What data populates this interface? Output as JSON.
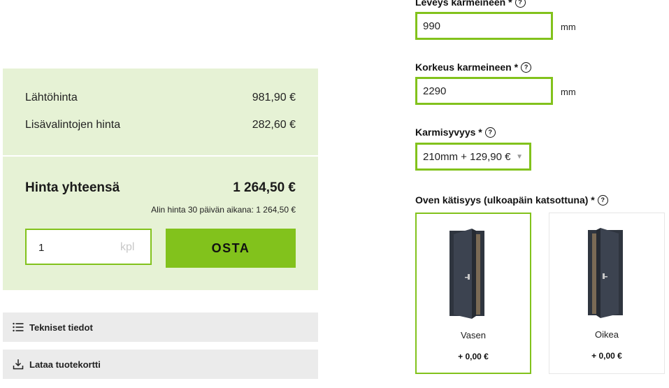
{
  "pricing": {
    "base_label": "Lähtöhinta",
    "base_value": "981,90 €",
    "extras_label": "Lisävalintojen hinta",
    "extras_value": "282,60 €",
    "total_label": "Hinta yhteensä",
    "total_value": "1 264,50 €",
    "lowest_price_note": "Alin hinta 30 päivän aikana: 1 264,50 €"
  },
  "purchase": {
    "quantity": "1",
    "quantity_unit": "kpl",
    "buy_label": "OSTA"
  },
  "accordions": {
    "tech_label": "Tekniset tiedot",
    "download_label": "Lataa tuotekortti"
  },
  "form": {
    "width_label": "Leveys karmeineen *",
    "width_value": "990",
    "width_unit": "mm",
    "height_label": "Korkeus karmeineen *",
    "height_value": "2290",
    "height_unit": "mm",
    "depth_label": "Karmisyvyys *",
    "depth_value": "210mm + 129,90 €",
    "handedness_label": "Oven kätisyys (ulkoapäin katsottuna) *",
    "help_glyph": "?",
    "options": [
      {
        "label": "Vasen",
        "price": "+ 0,00 €",
        "selected": true
      },
      {
        "label": "Oikea",
        "price": "+ 0,00 €",
        "selected": false
      }
    ]
  },
  "colors": {
    "accent": "#82c21c",
    "panel_bg": "#e6f2d5",
    "accordion_bg": "#ebebeb",
    "door_color": "#3c4350"
  },
  "icons": {
    "tech": "list-icon",
    "download": "download-icon",
    "help": "help-circle-icon",
    "caret": "caret-down-icon"
  }
}
